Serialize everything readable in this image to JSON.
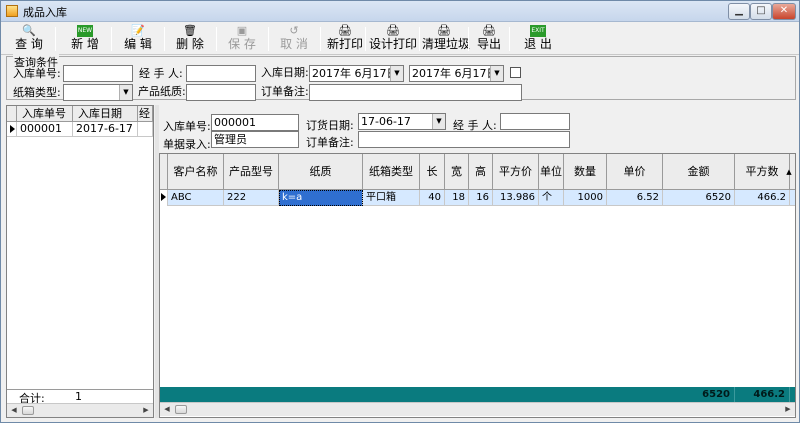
{
  "window": {
    "title": "成品入库"
  },
  "toolbar": {
    "query": "查 询",
    "new": "新 增",
    "edit": "编 辑",
    "delete": "删 除",
    "save": "保 存",
    "cancel": "取 消",
    "new_print": "新打印",
    "design_print": "设计打印",
    "clear_junk": "清理垃圾",
    "export": "导出",
    "exit": "退 出"
  },
  "query": {
    "legend": "查询条件",
    "label_order_no": "入库单号:",
    "label_handler": "经 手 人:",
    "label_date": "入库日期:",
    "date_from": "2017年 6月17日",
    "date_to": "2017年 6月17日",
    "label_box_type": "纸箱类型:",
    "label_paper": "产品纸质:",
    "label_remark": "订单备注:"
  },
  "left_list": {
    "headers": [
      "入库单号",
      "入库日期",
      "经"
    ],
    "rows": [
      {
        "order_no": "000001",
        "date": "2017-6-17"
      }
    ],
    "footer_label": "合计:",
    "footer_value": "1"
  },
  "detail": {
    "label_order_no": "入库单号:",
    "order_no": "000001",
    "label_order_date": "订货日期:",
    "order_date": "17-06-17",
    "label_handler": "经 手 人:",
    "handler": "",
    "label_entry": "单据录入:",
    "entry": "管理员",
    "label_remark": "订单备注:",
    "remark": ""
  },
  "grid": {
    "headers": [
      "客户名称",
      "产品型号",
      "纸质",
      "纸箱类型",
      "长",
      "宽",
      "高",
      "平方价",
      "单位",
      "数量",
      "单价",
      "金额",
      "平方数"
    ],
    "row": {
      "customer": "ABC",
      "model": "222",
      "paper": "k=a",
      "box_type": "平口箱",
      "length": "40",
      "width": "18",
      "height": "16",
      "sq_price": "13.986",
      "unit": "个",
      "qty": "1000",
      "unit_price": "6.52",
      "amount": "6520",
      "sq": "466.2"
    },
    "totals": {
      "amount": "6520",
      "sq": "466.2"
    }
  }
}
